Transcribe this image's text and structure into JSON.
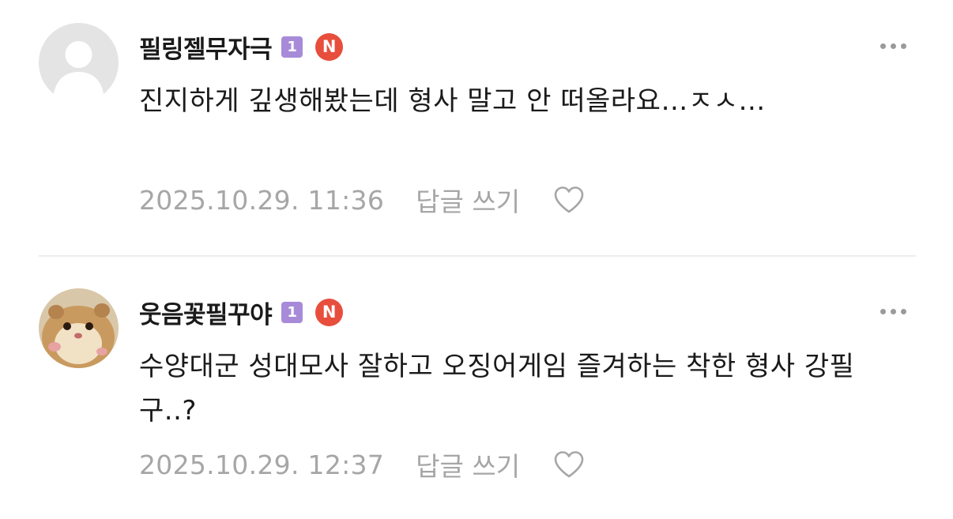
{
  "comments": [
    {
      "nickname": "필링젤무자극",
      "level_badge": "1",
      "n_badge": "N",
      "text": "진지하게 깊생해봤는데 형사 말고 안 떠올라요…ㅈㅅ…",
      "date": "2025.10.29. 11:36",
      "reply_label": "답글 쓰기",
      "avatar": "default-profile-icon"
    },
    {
      "nickname": "웃음꽃필꾸야",
      "level_badge": "1",
      "n_badge": "N",
      "text": "수양대군 성대모사 잘하고 오징어게임 즐겨하는 착한 형사 강필구..?",
      "date": "2025.10.29. 12:37",
      "reply_label": "답글 쓰기",
      "avatar": "hamster-photo"
    }
  ],
  "colors": {
    "level_badge": "#a78bd9",
    "n_badge": "#e84e3c",
    "meta_text": "#a6a6a6"
  }
}
